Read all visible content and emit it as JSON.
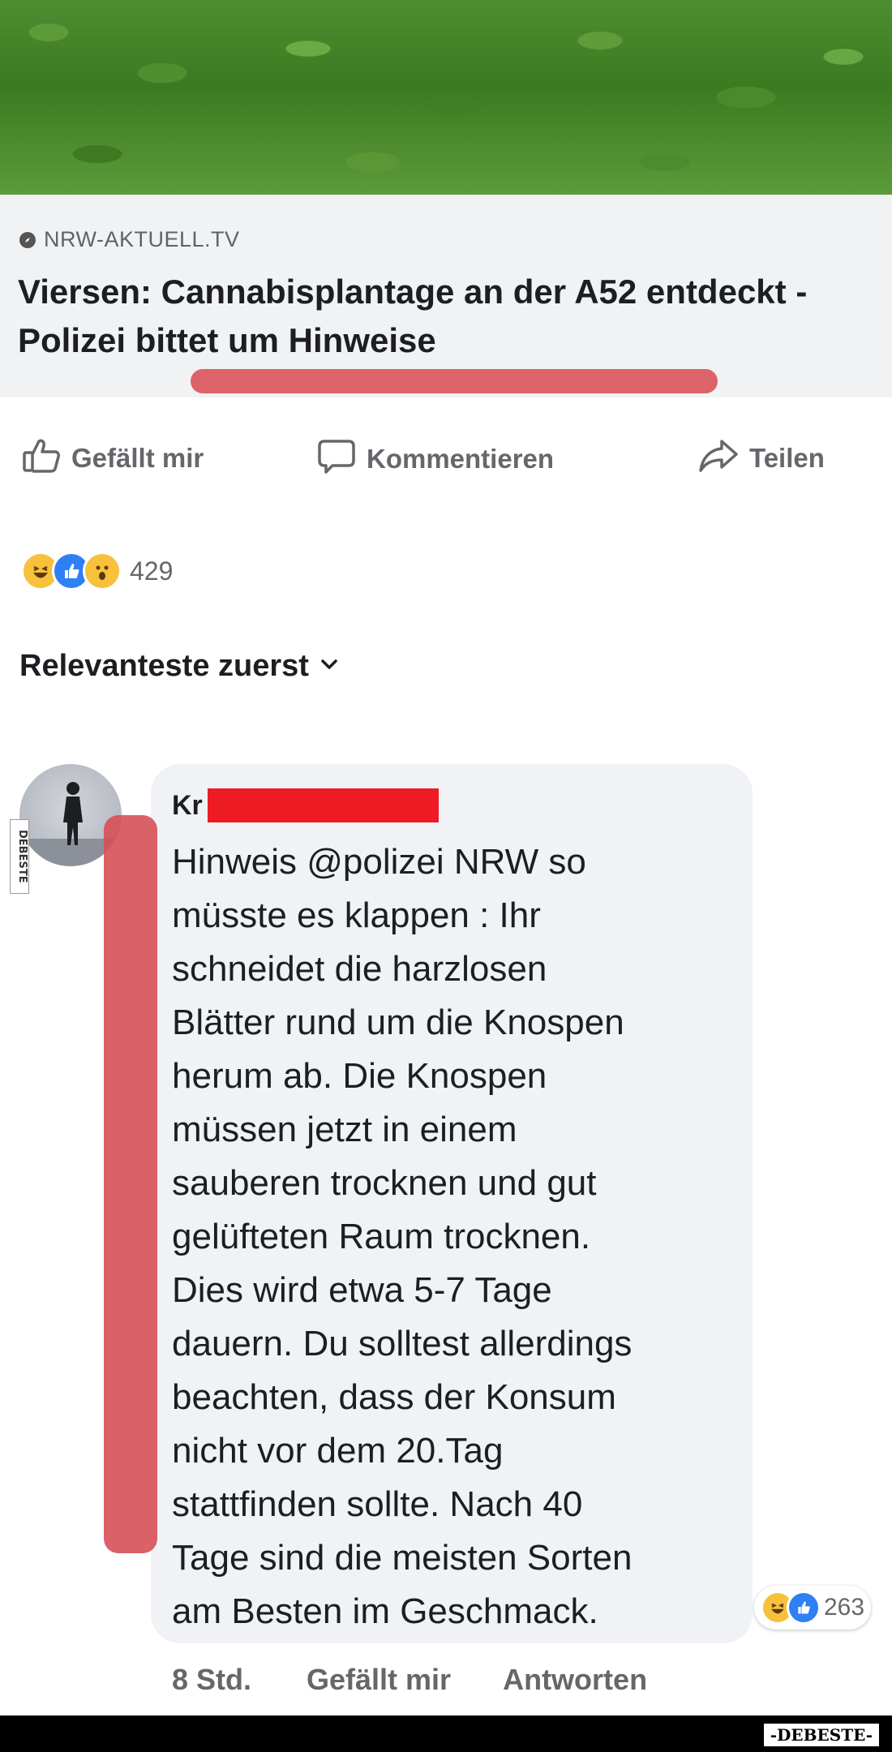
{
  "link_preview": {
    "source": "NRW-AKTUELL.TV",
    "headline": "Viersen: Cannabisplantage an der A52 entdeckt - Polizei bittet um Hinweise"
  },
  "actions": {
    "like": "Gefällt mir",
    "comment": "Kommentieren",
    "share": "Teilen"
  },
  "reactions": {
    "icons": [
      "haha-reaction-icon",
      "like-reaction-icon",
      "wow-reaction-icon"
    ],
    "count": "429"
  },
  "comments_sort": {
    "label": "Relevanteste zuerst"
  },
  "comment": {
    "author_visible": "Kr",
    "text": "Hinweis @polizei NRW so\nmüsste es klappen : Ihr\nschneidet die harzlosen\nBlätter rund um die Knospen\nherum ab. Die Knospen\nmüssen jetzt in einem\nsauberen trocknen und gut\ngelüfteten Raum trocknen.\nDies wird etwa 5-7 Tage\ndauern. Du solltest allerdings\nbeachten, dass der Konsum\nnicht vor dem 20.Tag\nstattfinden sollte. Nach 40\nTage sind die meisten Sorten\nam Besten im Geschmack.",
    "reaction_count": "263",
    "time": "8 Std.",
    "like_label": "Gefällt mir",
    "reply_label": "Antworten"
  },
  "watermark": "-DEBESTE-",
  "side_badge": "DEBESTE",
  "colors": {
    "annotation_red": "#d75058",
    "redaction_red": "#ee1b25",
    "text_primary": "#1c1e21",
    "text_secondary": "#65676b",
    "bubble_bg": "#f0f2f5",
    "like_blue": "#2f7ff5",
    "emoji_yellow": "#f7c13c"
  }
}
